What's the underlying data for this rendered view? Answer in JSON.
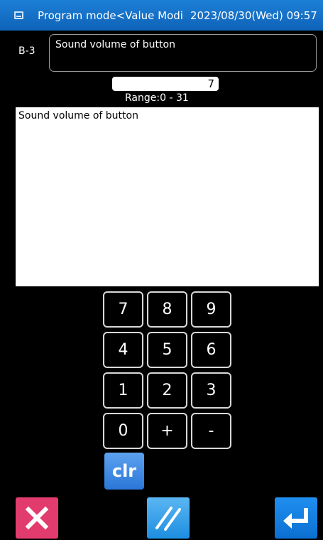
{
  "titlebar": {
    "icon": "app-window-icon",
    "title": "Program mode<Value Modi",
    "datetime": "2023/08/30(Wed) 09:57"
  },
  "parameter": {
    "code": "B-3",
    "name": "Sound volume of button",
    "value": "7",
    "range": "Range:0  -  31",
    "description": "Sound volume of button"
  },
  "keypad": {
    "keys": [
      "7",
      "8",
      "9",
      "4",
      "5",
      "6",
      "1",
      "2",
      "3",
      "0",
      "+",
      "-"
    ],
    "clear_label": "clr"
  },
  "bottom_bar": {
    "cancel_icon": "close-icon",
    "menu_icon": "double-slash-icon",
    "enter_icon": "enter-icon",
    "colors": {
      "cancel": "#e23c6f",
      "menu": "#3aa3ea",
      "enter": "#137fe0"
    }
  },
  "colors": {
    "titlebar": "#1570c8",
    "background": "#000000",
    "panel": "#ffffff"
  }
}
